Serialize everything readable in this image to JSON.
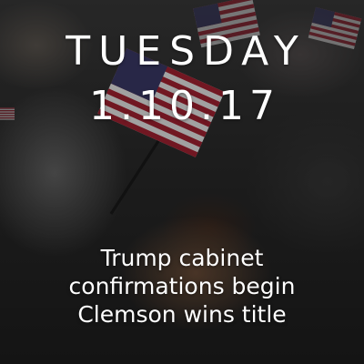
{
  "header": {
    "day": "TUESDAY",
    "date": "1.10.17"
  },
  "stories": [
    "Trump cabinet",
    "confirmations begin",
    "Clemson wins title"
  ],
  "colors": {
    "text": "#ffffff",
    "flag_red": "#b22234",
    "flag_blue": "#3c3b6e",
    "overlay": "#000000"
  },
  "background": {
    "image_subject": "flag-waving-crowd-photo"
  }
}
